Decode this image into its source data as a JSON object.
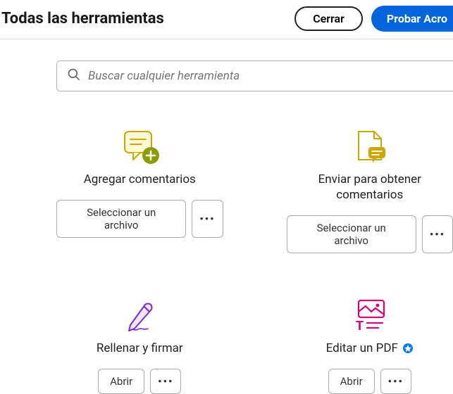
{
  "header": {
    "title": "Todas las herramientas",
    "close_label": "Cerrar",
    "try_label": "Probar Acro"
  },
  "search": {
    "placeholder": "Buscar cualquier herramienta"
  },
  "tools": {
    "add_comments": {
      "title": "Agregar comentarios",
      "action": "Seleccionar un archivo",
      "more": "•••"
    },
    "send_comments": {
      "title": "Enviar para obtener comentarios",
      "action": "Seleccionar un archivo",
      "more": "•••"
    },
    "fill_sign": {
      "title": "Rellenar y firmar",
      "action": "Abrir",
      "more": "•••"
    },
    "edit_pdf": {
      "title": "Editar un PDF",
      "action": "Abrir",
      "more": "•••"
    }
  }
}
